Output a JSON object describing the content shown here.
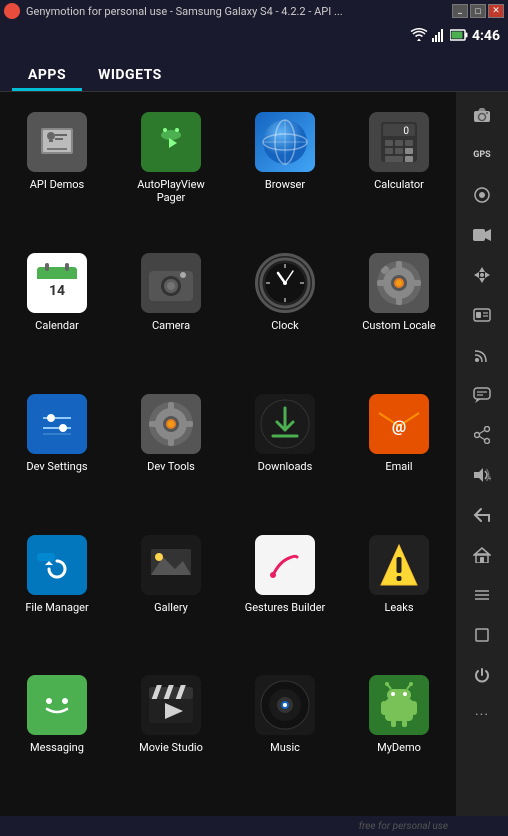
{
  "titleBar": {
    "title": "Genymotion for personal use - Samsung Galaxy S4 - 4.2.2 - API ...",
    "winButtons": [
      "_",
      "□",
      "✕"
    ]
  },
  "statusBar": {
    "time": "4:46",
    "icons": [
      "wifi",
      "signal",
      "battery"
    ]
  },
  "tabs": [
    {
      "id": "apps",
      "label": "APPS",
      "active": true
    },
    {
      "id": "widgets",
      "label": "WIDGETS",
      "active": false
    }
  ],
  "apps": [
    {
      "id": "api-demos",
      "label": "API Demos",
      "iconType": "folder-gear"
    },
    {
      "id": "autoplay",
      "label": "AutoPlayView Pager",
      "iconType": "android-green"
    },
    {
      "id": "browser",
      "label": "Browser",
      "iconType": "globe"
    },
    {
      "id": "calculator",
      "label": "Calculator",
      "iconType": "calculator"
    },
    {
      "id": "calendar",
      "label": "Calendar",
      "iconType": "calendar"
    },
    {
      "id": "camera",
      "label": "Camera",
      "iconType": "camera"
    },
    {
      "id": "clock",
      "label": "Clock",
      "iconType": "clock"
    },
    {
      "id": "custom-locale",
      "label": "Custom Locale",
      "iconType": "gear-orange"
    },
    {
      "id": "dev-settings",
      "label": "Dev Settings",
      "iconType": "sliders"
    },
    {
      "id": "dev-tools",
      "label": "Dev Tools",
      "iconType": "gear-anim"
    },
    {
      "id": "downloads",
      "label": "Downloads",
      "iconType": "download-arrow"
    },
    {
      "id": "email",
      "label": "Email",
      "iconType": "email"
    },
    {
      "id": "file-manager",
      "label": "File Manager",
      "iconType": "file-mgr"
    },
    {
      "id": "gallery",
      "label": "Gallery",
      "iconType": "gallery"
    },
    {
      "id": "gestures-builder",
      "label": "Gestures Builder",
      "iconType": "gestures"
    },
    {
      "id": "leaks",
      "label": "Leaks",
      "iconType": "shield"
    },
    {
      "id": "messaging",
      "label": "Messaging",
      "iconType": "chat"
    },
    {
      "id": "movie-studio",
      "label": "Movie Studio",
      "iconType": "film"
    },
    {
      "id": "music",
      "label": "Music",
      "iconType": "speaker"
    },
    {
      "id": "mydemo",
      "label": "MyDemo",
      "iconType": "android-plain"
    }
  ],
  "sidebar": {
    "buttons": [
      {
        "id": "camera-side",
        "icon": "📷",
        "name": "camera-side-button"
      },
      {
        "id": "gps",
        "icon": "GPS",
        "name": "gps-button",
        "text": true
      },
      {
        "id": "webcam",
        "icon": "⊙",
        "name": "webcam-button"
      },
      {
        "id": "video",
        "icon": "▦",
        "name": "video-button"
      },
      {
        "id": "move",
        "icon": "✛",
        "name": "move-button"
      },
      {
        "id": "id-card",
        "icon": "▣",
        "name": "id-card-button"
      },
      {
        "id": "rss",
        "icon": "◉",
        "name": "rss-button"
      },
      {
        "id": "chat-bubble",
        "icon": "▤",
        "name": "chat-side-button"
      },
      {
        "id": "share",
        "icon": "◁",
        "name": "share-button"
      },
      {
        "id": "volume",
        "icon": "🔊",
        "name": "volume-button"
      },
      {
        "id": "back",
        "icon": "↩",
        "name": "back-button"
      },
      {
        "id": "home",
        "icon": "⬚",
        "name": "home-button"
      },
      {
        "id": "menu-hw",
        "icon": "☰",
        "name": "menu-hw-button"
      },
      {
        "id": "overview",
        "icon": "⬜",
        "name": "overview-button"
      },
      {
        "id": "power",
        "icon": "⏻",
        "name": "power-button"
      },
      {
        "id": "more",
        "icon": "···",
        "name": "more-button"
      }
    ]
  },
  "bottomBar": {
    "freeText": "free for personal use"
  }
}
